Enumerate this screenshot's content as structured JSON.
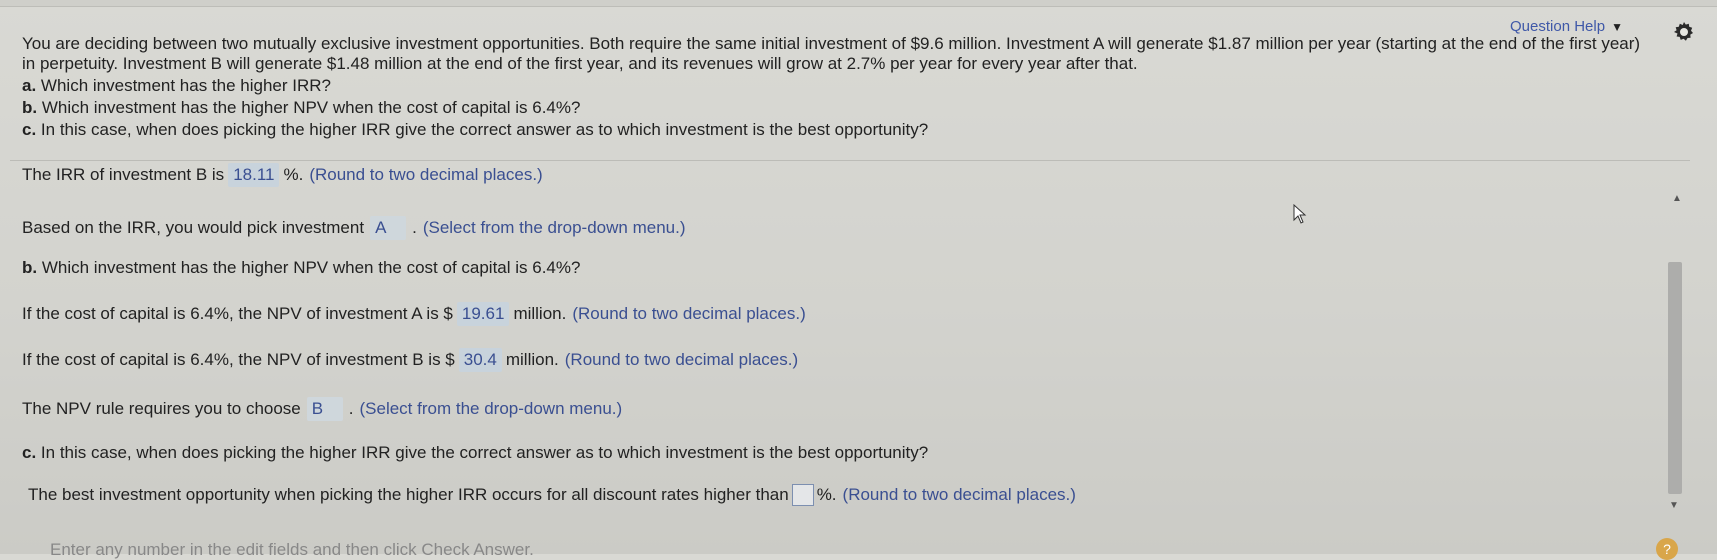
{
  "header": {
    "question_help_label": "Question Help",
    "dropdown_icon": "triangle-down-icon",
    "settings_icon": "gear-icon"
  },
  "problem": {
    "statement_line1": "You are deciding between two mutually exclusive investment opportunities. Both require the same initial investment of $9.6 million. Investment A will generate $1.87 million per year (starting at the end of the first year)",
    "statement_line2": "in perpetuity. Investment B will generate $1.48 million at the end of the first year, and its revenues will grow at 2.7% per year for every year after that.",
    "part_a_letter": "a.",
    "part_a_text": "Which investment has the higher IRR?",
    "part_b_letter": "b.",
    "part_b_text": "Which investment has the higher NPV when the cost of capital is 6.4%?",
    "part_c_letter": "c.",
    "part_c_text": "In this case, when does picking the higher IRR give the correct answer as to which investment is the best opportunity?"
  },
  "work": {
    "irr_b_prefix": "The IRR of investment B is",
    "irr_b_value": "18.11",
    "irr_b_suffix": "%.",
    "irr_b_hint": "(Round to two decimal places.)",
    "irr_pick_prefix": "Based on the IRR, you would pick investment",
    "irr_pick_value": "A",
    "irr_pick_suffix": ".",
    "irr_pick_hint": "(Select from the drop-down menu.)",
    "part_b_letter": "b.",
    "part_b_text": "Which investment has the higher NPV when the cost of capital is 6.4%?",
    "npv_a_prefix": "If the cost of capital is 6.4%, the NPV of investment A is $",
    "npv_a_value": "19.61",
    "npv_a_suffix": "million.",
    "npv_a_hint": "(Round to two decimal places.)",
    "npv_b_prefix": "If the cost of capital is 6.4%, the NPV of investment B is $",
    "npv_b_value": "30.4",
    "npv_b_suffix": "million.",
    "npv_b_hint": "(Round to two decimal places.)",
    "npv_rule_prefix": "The NPV rule requires you to choose",
    "npv_rule_value": "B",
    "npv_rule_suffix": ".",
    "npv_rule_hint": "(Select from the drop-down menu.)",
    "part_c_letter": "c.",
    "part_c_text": "In this case, when does picking the higher IRR give the correct answer as to which investment is the best opportunity?",
    "best_prefix": "The best investment opportunity when picking the higher IRR occurs for all discount rates higher than",
    "best_suffix": "%.",
    "best_hint": "(Round to two decimal places.)"
  },
  "footer": {
    "instruction_partial": "Enter any number in the edit fields and then click Check Answer.",
    "help_label": "?"
  },
  "colors": {
    "answer_text": "#3a4f91",
    "answer_bg": "#c8d3dc",
    "link": "#3f58a8"
  }
}
